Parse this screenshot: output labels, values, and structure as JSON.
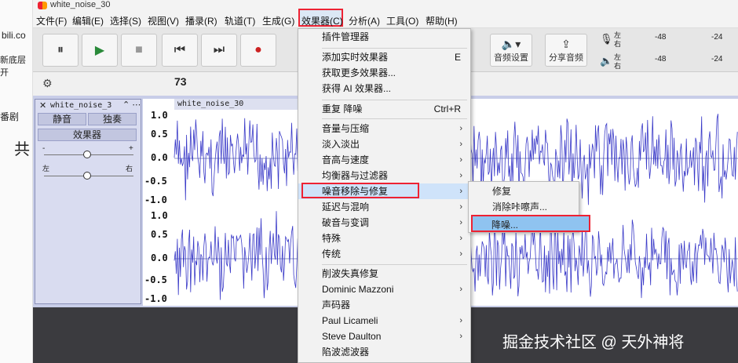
{
  "window": {
    "title": "white_noise_30"
  },
  "left_strip": {
    "site": "bili.co",
    "lines": [
      "新底层开",
      "番剧",
      "共"
    ]
  },
  "menubar": {
    "items": [
      "文件(F)",
      "编辑(E)",
      "选择(S)",
      "视图(V)",
      "播录(R)",
      "轨道(T)",
      "生成(G)",
      "效果器(C)",
      "分析(A)",
      "工具(O)",
      "帮助(H)"
    ]
  },
  "toolbar": {
    "pause": "⏸",
    "play": "▶",
    "stop": "■",
    "skip_start": "⏮",
    "skip_end": "⏭",
    "record": "●",
    "audio_settings": "音频设置",
    "share_audio": "分享音频",
    "meter_left": "左",
    "meter_right": "右",
    "meter_mark1": "-48",
    "meter_mark2": "-24"
  },
  "status": {
    "rate": "73"
  },
  "track": {
    "name": "white_noise_3",
    "mute": "静音",
    "solo": "独奏",
    "effects": "效果器",
    "gain_minus": "-",
    "gain_plus": "+",
    "pan_left": "左",
    "pan_right": "右",
    "clip_name": "white_noise_30",
    "ticks": [
      "1.0",
      "0.5",
      "0.0",
      "-0.5",
      "-1.0",
      "1.0",
      "0.5",
      "0.0",
      "-0.5",
      "-1.0"
    ]
  },
  "effects_menu": {
    "plugin_manager": "插件管理器",
    "add_realtime": "添加实时效果器",
    "add_realtime_shortcut": "E",
    "get_more": "获取更多效果器...",
    "get_ai": "获得 AI 效果器...",
    "repeat": "重复 降噪",
    "repeat_shortcut": "Ctrl+R",
    "items": [
      "音量与压缩",
      "淡入淡出",
      "音高与速度",
      "均衡器与过滤器",
      "噪音移除与修复",
      "延迟与混响",
      "破音与变调",
      "特殊",
      "传统"
    ],
    "vendor_items": [
      "削波失真修复",
      "Dominic Mazzoni",
      "声码器",
      "Paul Licameli",
      "Steve Daulton",
      "陷波滤波器"
    ]
  },
  "noise_submenu": {
    "items": [
      "修复",
      "消除咔嚓声...",
      "降噪..."
    ]
  },
  "watermark": "掘金技术社区 @ 天外神将",
  "colors": {
    "highlight_box": "#e23333",
    "selection": "#8fc3f0",
    "waveform": "#3a3ac8"
  }
}
